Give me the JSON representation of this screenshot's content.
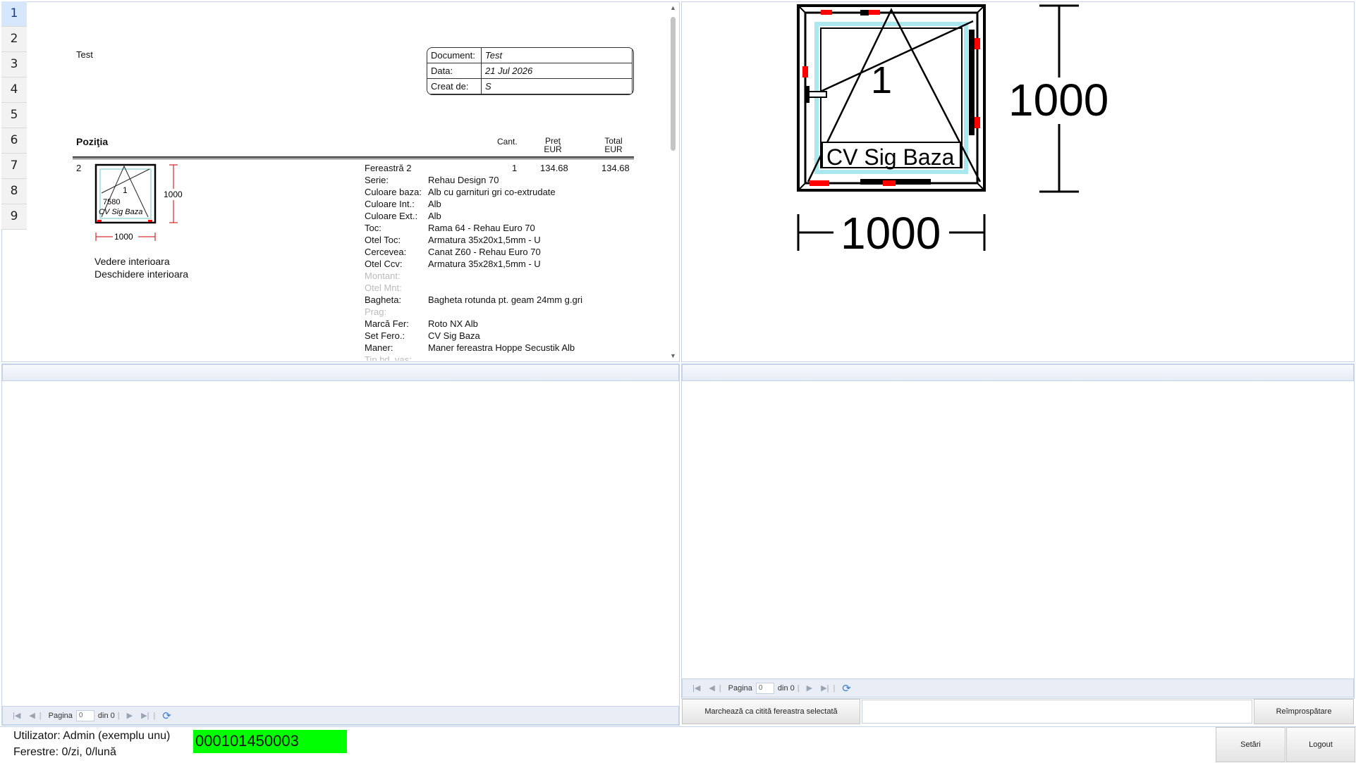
{
  "tabs": [
    "1",
    "2",
    "3",
    "4",
    "5",
    "6",
    "7",
    "8",
    "9"
  ],
  "active_tab": "1",
  "report": {
    "client": "Test",
    "meta": [
      {
        "label": "Document:",
        "value": "Test"
      },
      {
        "label": "Data:",
        "value": "21 Jul 2026"
      },
      {
        "label": "Creat de:",
        "value": "S"
      }
    ],
    "headers": {
      "position": "Poziţia",
      "qty": "Cant.",
      "price": "Preţ\nEUR",
      "total": "Total\nEUR"
    },
    "item": {
      "index": "2",
      "title": "Fereastră 2",
      "qty": "1",
      "price": "134.68",
      "total": "134.68",
      "thumb_width": "1000",
      "thumb_height": "1000",
      "thumb_sash": "1",
      "thumb_label_a": "7580",
      "thumb_label_b": "CV Sig Baza",
      "view_notes": [
        "Vedere interioara",
        "Deschidere interioara"
      ],
      "specs": [
        {
          "label": "Serie:",
          "value": "Rehau Design 70"
        },
        {
          "label": "Culoare baza:",
          "value": "Alb cu garnituri gri co-extrudate"
        },
        {
          "label": "Culoare Int.:",
          "value": "Alb"
        },
        {
          "label": "Culoare Ext.:",
          "value": "Alb"
        },
        {
          "label": "Toc:",
          "value": "Rama 64 - Rehau Euro 70"
        },
        {
          "label": "Otel Toc:",
          "value": "Armatura 35x20x1,5mm - U"
        },
        {
          "label": "Cercevea:",
          "value": "Canat Z60 - Rehau Euro 70"
        },
        {
          "label": "Otel Ccv:",
          "value": "Armatura 35x28x1,5mm - U"
        },
        {
          "label": "Montant:",
          "value": "",
          "muted": true
        },
        {
          "label": "Otel Mnt:",
          "value": "",
          "muted": true
        },
        {
          "label": "Bagheta:",
          "value": "Bagheta rotunda pt. geam 24mm g.gri"
        },
        {
          "label": "Prag:",
          "value": "",
          "muted": true
        },
        {
          "label": "Marcă Fer:",
          "value": "Roto NX Alb"
        },
        {
          "label": "Set Fero.:",
          "value": "CV Sig Baza"
        },
        {
          "label": "Maner:",
          "value": "Maner fereastra Hoppe Secustik Alb"
        },
        {
          "label": "Tip bd. vas:",
          "value": "",
          "muted": true
        }
      ]
    }
  },
  "drawing": {
    "height_dim": "1000",
    "width_dim": "1000",
    "sash_number": "1",
    "hardware_label": "CV Sig Baza",
    "frame_color": "#000000",
    "glass_color": "#a8e8ee",
    "marker_color": "#ff0000"
  },
  "pager_left": {
    "page_label": "Pagina",
    "page_value": "0",
    "of_label": "din 0"
  },
  "pager_right": {
    "page_label": "Pagina",
    "page_value": "0",
    "of_label": "din 0"
  },
  "actions": {
    "mark_read": "Marchează ca citită fereastra selectată",
    "refresh": "Reîmprospătare",
    "input_value": ""
  },
  "status": {
    "user": "Utilizator: Admin (exemplu unu)",
    "windows": "Ferestre: 0/zi, 0/lună",
    "code": "000101450003",
    "code_color": "#00ff00"
  },
  "footer_buttons": {
    "settings": "Setări",
    "logout": "Logout"
  }
}
